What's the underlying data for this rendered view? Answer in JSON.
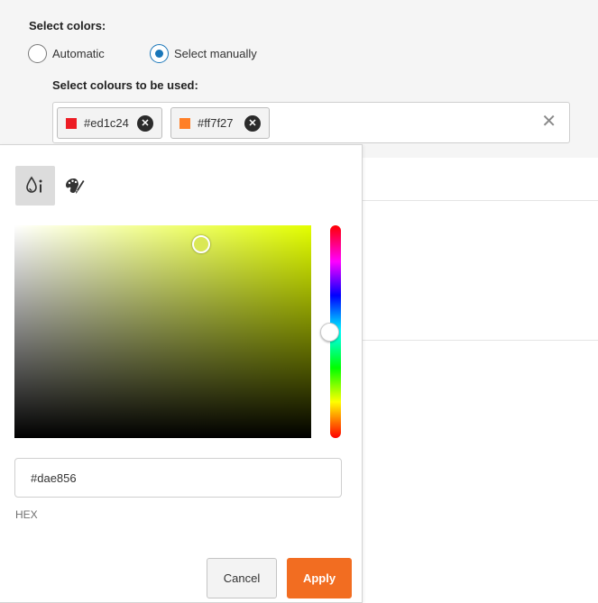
{
  "color_selection": {
    "title": "Select colors:",
    "mode_options": [
      {
        "label": "Automatic",
        "checked": false
      },
      {
        "label": "Select manually",
        "checked": true
      }
    ],
    "colors_label": "Select colours to be used:",
    "selected_colors": [
      {
        "hex": "#ed1c24",
        "swatch": "#ed1c24",
        "remove_icon": "close-circle-icon"
      },
      {
        "hex": "#ff7f27",
        "swatch": "#ff7f27",
        "remove_icon": "close-circle-icon"
      }
    ],
    "clear_icon": "clear-x-icon",
    "clear_glyph": "✕"
  },
  "color_picker": {
    "tabs": [
      {
        "icon": "color-drop-picker-icon",
        "active": true
      },
      {
        "icon": "palette-brush-icon",
        "active": false
      }
    ],
    "hue_color": "#e4ff00",
    "hex_value": "#dae856",
    "hex_caption": "HEX",
    "cancel_label": "Cancel",
    "apply_label": "Apply",
    "apply_color": "#f26d21"
  }
}
